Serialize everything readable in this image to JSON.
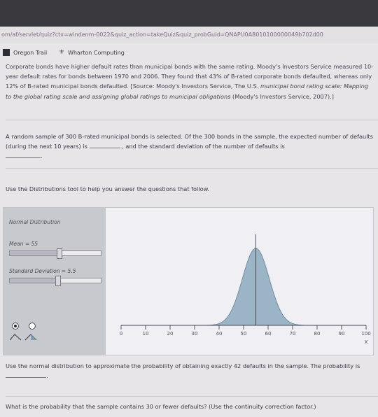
{
  "browser": {
    "url": "om/af/servlet/quiz?ctx=windenm-0022&quiz_action=takeQuiz&quiz_probGuid=QNAPU0A8010100000049b702d00"
  },
  "bookmarks": [
    {
      "label": "Oregon Trail",
      "icon": "square-icon"
    },
    {
      "label": "Wharton Computing",
      "icon": "wharton-logo-icon"
    }
  ],
  "problem": {
    "intro_top": "Corporate bonds have higher default rates than municipal bonds with the same rating. Moody's Investors Service",
    "intro_rest": "measured 10-year default rates for bonds between 1970 and 2006. They found that 43% of B-rated corporate bonds defaulted, whereas only 12% of B-rated municipal bonds defaulted. [Source: Moody's Investors Service, The U.S.",
    "intro_italic": "municipal bond rating scale: Mapping to the global rating scale and assigning global ratings to municipal obligations",
    "intro_end": "(Moody's Investors Service, 2007).]",
    "question_a": "A random sample of 300 B-rated municipal bonds is selected. Of the 300 bonds in the sample, the expected number of defaults (during the next 10 years) is",
    "question_b": ", and the standard deviation of the number of defaults is",
    "question_c": ".",
    "instructions": "Use the Distributions tool to help you answer the questions that follow."
  },
  "tool": {
    "panel_title": "Normal Distribution",
    "mean_label": "Mean = 55",
    "mean_value": 55,
    "sd_label": "Standard Deviation = 5.5",
    "sd_value": 5.5,
    "x_axis_ticks": [
      "0",
      "10",
      "20",
      "30",
      "40",
      "50",
      "60",
      "70",
      "80",
      "90",
      "100"
    ],
    "x_axis_label": "X",
    "x_min": 0,
    "x_max": 100,
    "curve_color": "#9cb5c6",
    "line_color": "#2b2b33"
  },
  "followups": {
    "q2_text": "Use the normal distribution to approximate the probability of obtaining exactly 42 defaults in the sample. The probability is",
    "q2_end": ".",
    "q3_text": "What is the probability that the sample contains 30 or fewer defaults? (Use the continuity correction factor.)"
  }
}
